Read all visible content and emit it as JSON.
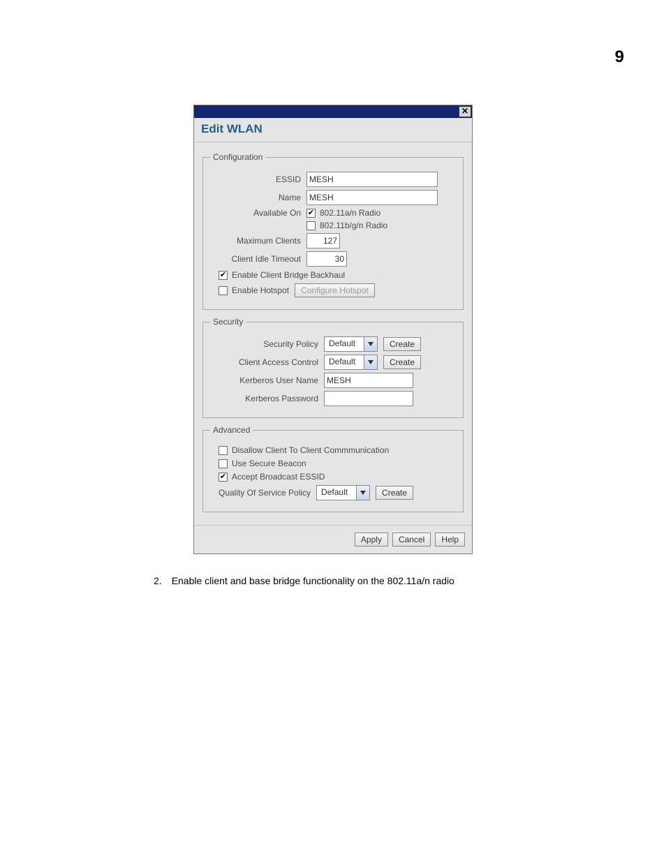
{
  "page": {
    "number": "9"
  },
  "dialog": {
    "title": "Edit WLAN",
    "config": {
      "legend": "Configuration",
      "essid_label": "ESSID",
      "essid_value": "MESH",
      "name_label": "Name",
      "name_value": "MESH",
      "available_label": "Available On",
      "radio_a": {
        "label": "802.11a/n Radio",
        "checked": true
      },
      "radio_b": {
        "label": "802.11b/g/n Radio",
        "checked": false
      },
      "max_clients_label": "Maximum Clients",
      "max_clients_value": "127",
      "idle_label": "Client Idle Timeout",
      "idle_value": "30",
      "bridge": {
        "label": "Enable Client Bridge Backhaul",
        "checked": true
      },
      "hotspot": {
        "label": "Enable Hotspot",
        "checked": false,
        "button": "Configure Hotspot"
      }
    },
    "security": {
      "legend": "Security",
      "policy_label": "Security Policy",
      "policy_value": "Default",
      "policy_create": "Create",
      "acl_label": "Client Access Control",
      "acl_value": "Default",
      "acl_create": "Create",
      "krb_user_label": "Kerberos User Name",
      "krb_user_value": "MESH",
      "krb_pwd_label": "Kerberos Password",
      "krb_pwd_value": ""
    },
    "advanced": {
      "legend": "Advanced",
      "disallow": {
        "label": "Disallow Client To Client Commmunication",
        "checked": false
      },
      "secure_beacon": {
        "label": "Use Secure Beacon",
        "checked": false
      },
      "accept_bcast": {
        "label": "Accept Broadcast ESSID",
        "checked": true
      },
      "qos_label": "Quality Of Service Policy",
      "qos_value": "Default",
      "qos_create": "Create"
    },
    "footer": {
      "apply": "Apply",
      "cancel": "Cancel",
      "help": "Help"
    }
  },
  "caption": {
    "num": "2.",
    "text": "Enable client and base bridge functionality on the 802.11a/n radio"
  }
}
